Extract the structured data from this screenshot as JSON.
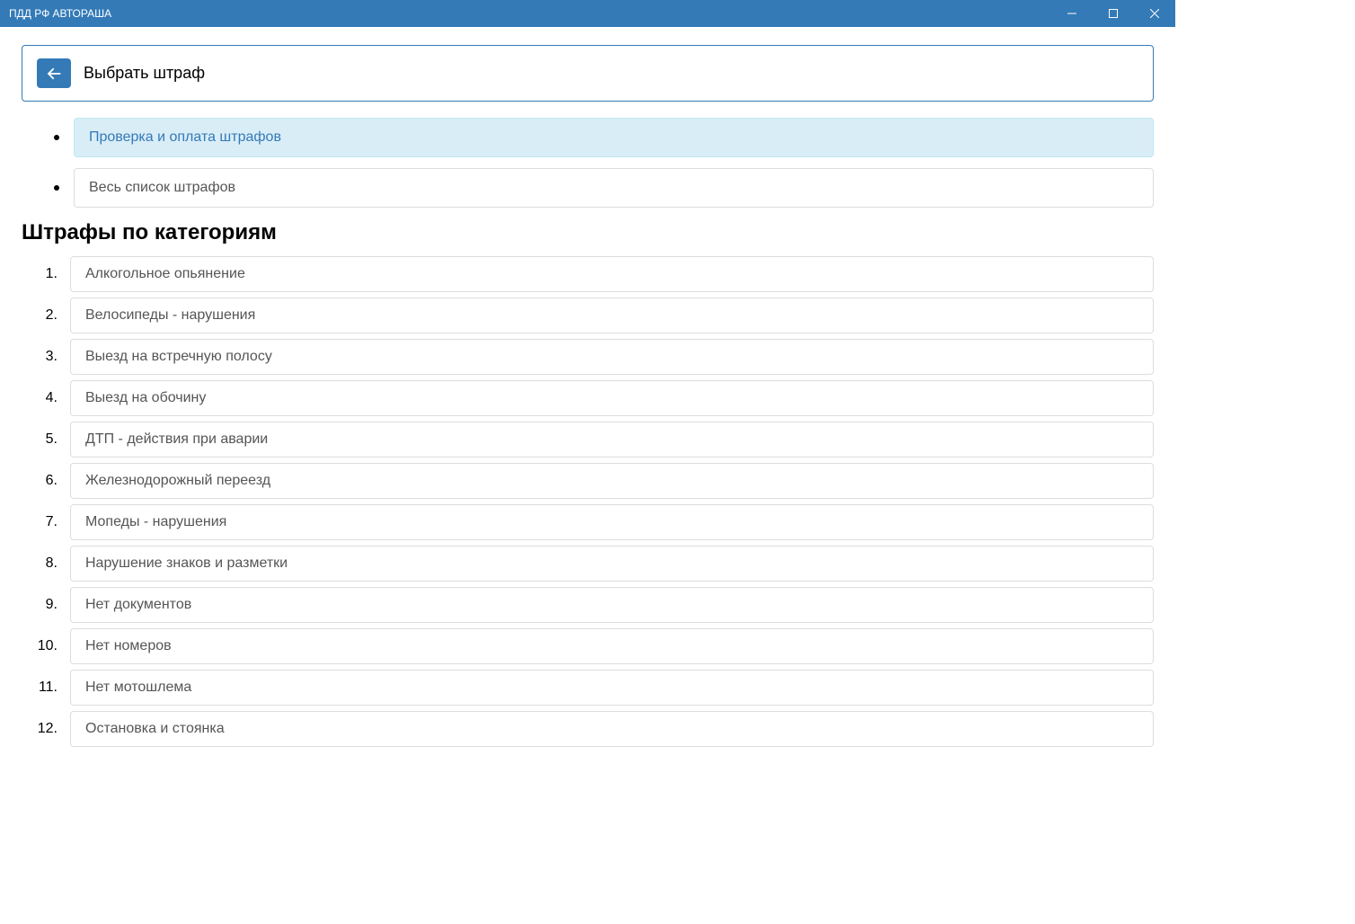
{
  "window": {
    "title": "ПДД РФ АВТОРАША"
  },
  "header": {
    "title": "Выбрать штраф"
  },
  "top_links": [
    {
      "label": "Проверка и оплата штрафов",
      "active": true
    },
    {
      "label": "Весь список штрафов",
      "active": false
    }
  ],
  "section_title": "Штрафы по категориям",
  "categories": [
    "Алкогольное опьянение",
    "Велосипеды - нарушения",
    "Выезд на встречную полосу",
    "Выезд на обочину",
    "ДТП - действия при аварии",
    "Железнодорожный переезд",
    "Мопеды - нарушения",
    "Нарушение знаков и разметки",
    "Нет документов",
    "Нет номеров",
    "Нет мотошлема",
    "Остановка и стоянка"
  ]
}
